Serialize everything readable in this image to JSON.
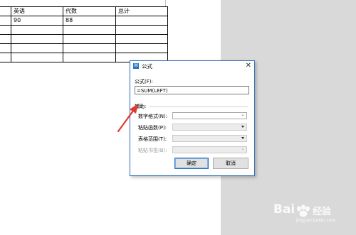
{
  "table": {
    "header": [
      "",
      "英语",
      "代数",
      "总计"
    ],
    "row1": [
      "",
      "90",
      "88",
      ""
    ]
  },
  "dialog": {
    "title": "公式",
    "close_symbol": "✕",
    "formula_label": "公式(F):",
    "formula_value": "=SUM(LEFT)",
    "helper_label": "辅助:",
    "number_format_label": "数字格式(N):",
    "paste_function_label": "粘贴函数(P):",
    "table_range_label": "表格范围(T):",
    "paste_bookmark_label": "粘贴书签(B):",
    "ok_label": "确定",
    "cancel_label": "取消"
  },
  "annotation": {
    "arrow_color": "#e03a2f"
  },
  "watermark": {
    "brand": "Bai",
    "brand_suffix": "经验",
    "url": "jingyan.baidu.com"
  }
}
